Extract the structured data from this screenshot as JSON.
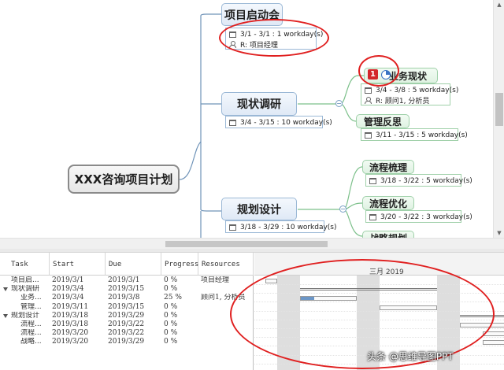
{
  "mindmap": {
    "root": "XXX咨询项目计划",
    "topics": {
      "kickoff": {
        "title": "项目启动会",
        "dates": "3/1 - 3/1 : 1 workday(s)",
        "resource": "R: 项目经理"
      },
      "research": {
        "title": "现状调研",
        "dates": "3/4 - 3/15 : 10 workday(s)"
      },
      "status": {
        "title": "业务现状",
        "dates": "3/4 - 3/8 : 5 workday(s)",
        "resource": "R: 顾问1, 分析员",
        "priority": "1",
        "progress": 0.25
      },
      "reflect": {
        "title": "管理反思",
        "dates": "3/11 - 3/15 : 5 workday(s)"
      },
      "design": {
        "title": "规划设计",
        "dates": "3/18 - 3/29 : 10 workday(s)"
      },
      "combing": {
        "title": "流程梳理",
        "dates": "3/18 - 3/22 : 5 workday(s)"
      },
      "optimize": {
        "title": "流程优化",
        "dates": "3/20 - 3/22 : 3 workday(s)"
      },
      "strategy": {
        "title": "战略规划"
      }
    },
    "collapse_symbol": "−"
  },
  "gantt": {
    "columns": [
      "Task",
      "Start",
      "Due",
      "Progress",
      "Resources"
    ],
    "rows": [
      {
        "task": "项目启...",
        "start": "2019/3/1",
        "due": "2019/3/1",
        "progress": "0 %",
        "resources": "项目经理",
        "indent": 0,
        "group": false
      },
      {
        "task": "现状调研",
        "start": "2019/3/4",
        "due": "2019/3/15",
        "progress": "0 %",
        "resources": "",
        "indent": 0,
        "group": true
      },
      {
        "task": "业务...",
        "start": "2019/3/4",
        "due": "2019/3/8",
        "progress": "25 %",
        "resources": "顾问1, 分析员",
        "indent": 1,
        "group": false
      },
      {
        "task": "管理...",
        "start": "2019/3/11",
        "due": "2019/3/15",
        "progress": "0 %",
        "resources": "",
        "indent": 1,
        "group": false
      },
      {
        "task": "规划设计",
        "start": "2019/3/18",
        "due": "2019/3/29",
        "progress": "0 %",
        "resources": "",
        "indent": 0,
        "group": true
      },
      {
        "task": "流程...",
        "start": "2019/3/18",
        "due": "2019/3/22",
        "progress": "0 %",
        "resources": "",
        "indent": 1,
        "group": false
      },
      {
        "task": "流程...",
        "start": "2019/3/20",
        "due": "2019/3/22",
        "progress": "0 %",
        "resources": "",
        "indent": 1,
        "group": false
      },
      {
        "task": "战略...",
        "start": "2019/3/20",
        "due": "2019/3/29",
        "progress": "0 %",
        "resources": "",
        "indent": 1,
        "group": false
      }
    ],
    "timeline_month": "三月 2019",
    "timeline_start": "2019/3/1",
    "progress_values": [
      0,
      0,
      0.25,
      0,
      0,
      0,
      0,
      0
    ]
  },
  "watermark": "头条 @思维导图PPT",
  "colors": {
    "annotation": "#e02020",
    "progress_fill": "#6b96c7",
    "level1_border": "#9bb8d6",
    "level2_border": "#9fd0a9"
  }
}
